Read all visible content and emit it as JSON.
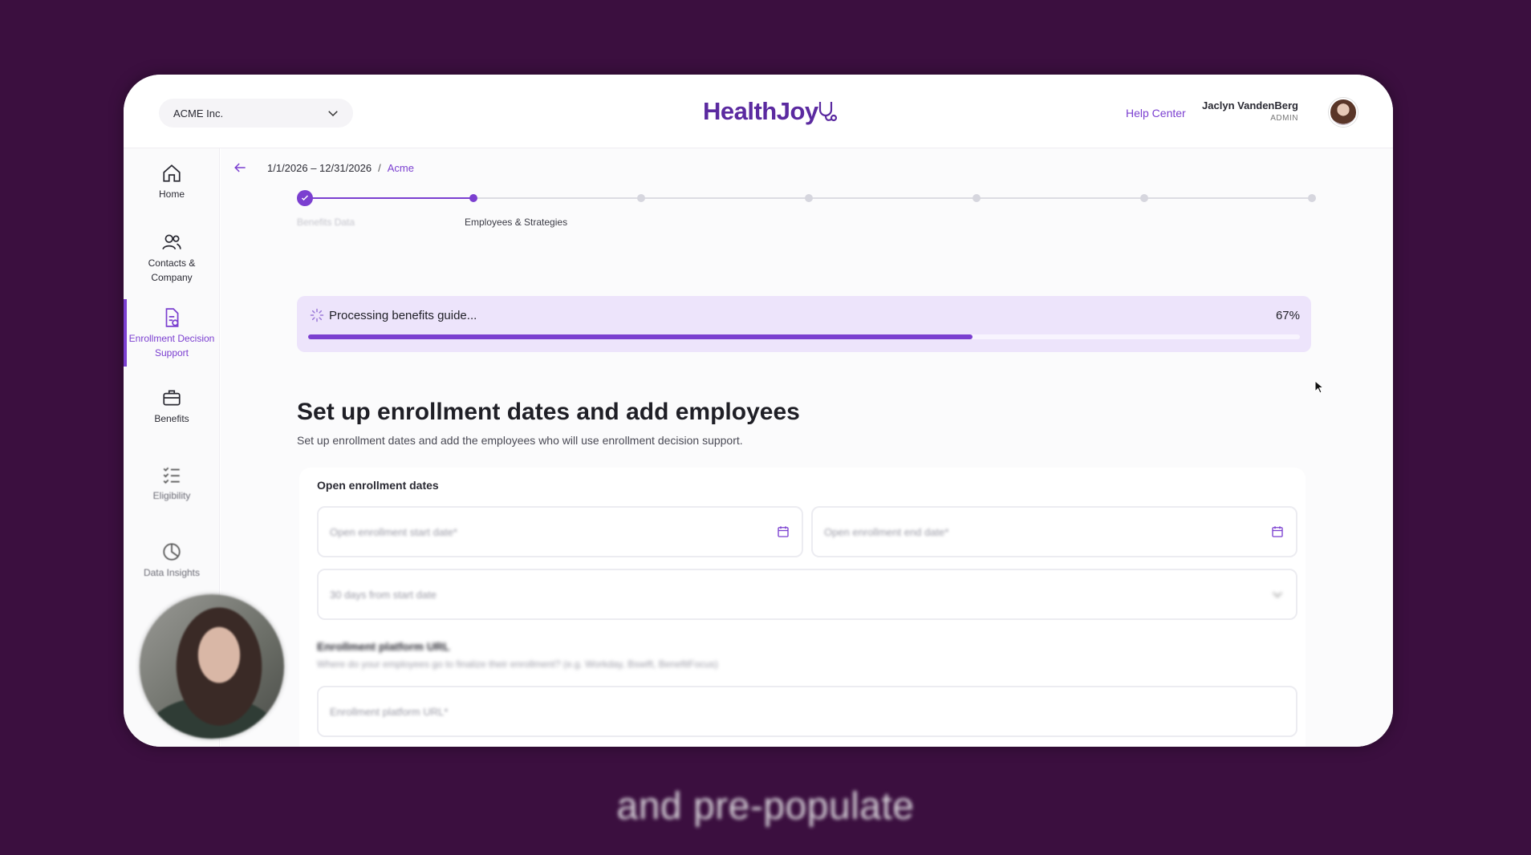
{
  "header": {
    "company_select": "ACME Inc.",
    "logo_text": "HealthJoy",
    "help_link": "Help Center",
    "user_name": "Jaclyn VandenBerg",
    "user_role": "ADMIN"
  },
  "sidebar": {
    "items": [
      {
        "label": "Home",
        "icon": "home-icon"
      },
      {
        "label": "Contacts & Company",
        "icon": "users-icon"
      },
      {
        "label": "Enrollment Decision Support",
        "icon": "document-icon"
      },
      {
        "label": "Benefits",
        "icon": "briefcase-icon"
      },
      {
        "label": "Eligibility",
        "icon": "checklist-icon"
      },
      {
        "label": "Data Insights",
        "icon": "chart-pie-icon"
      }
    ],
    "active": "Enrollment Decision Support"
  },
  "breadcrumb": {
    "date_range": "1/1/2026 – 12/31/2026",
    "separator": "/",
    "link": "Acme"
  },
  "stepper": {
    "step1_label": "Benefits Data",
    "step2_label": "Employees & Strategies",
    "completed_steps": 1,
    "current_step": 2,
    "total_steps": 7
  },
  "progress": {
    "text": "Processing benefits guide...",
    "percent_label": "67%",
    "value": 0.67
  },
  "main": {
    "heading": "Set up enrollment dates and add employees",
    "subheading": "Set up enrollment dates and add the employees who will use enrollment decision support."
  },
  "form": {
    "oe_section_label": "Open enrollment dates",
    "start_date_placeholder": "Open enrollment start date*",
    "end_date_placeholder": "Open enrollment end date*",
    "duration_value": "30 days from start date",
    "platform_label": "Enrollment platform URL",
    "platform_help": "Where do your employees go to finalize their enrollment? (e.g. Workday, Bswift, BenefitFocus)",
    "platform_placeholder": "Enrollment platform URL*"
  },
  "caption": "and pre-populate",
  "colors": {
    "accent": "#7b3fd0",
    "background": "#3b0f3f",
    "progress_bg": "#ede4fb"
  }
}
